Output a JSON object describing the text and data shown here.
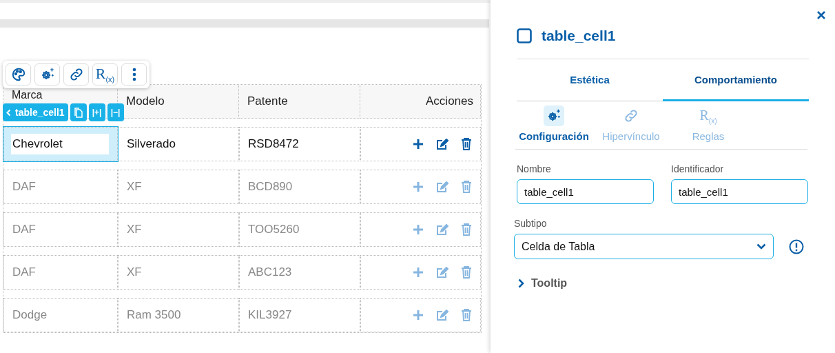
{
  "toolbar": [
    {
      "kind": "palette"
    },
    {
      "kind": "gear"
    },
    {
      "kind": "link"
    },
    {
      "kind": "rules",
      "text": "R$_{(x)}$"
    },
    {
      "kind": "more"
    }
  ],
  "element_chip": {
    "label": "table_cell1",
    "buttons": [
      {
        "kind": "copy"
      },
      {
        "kind": "text",
        "text": "|+|"
      },
      {
        "kind": "text",
        "text": "|−|"
      }
    ]
  },
  "table": {
    "columns": [
      "Marca",
      "Modelo",
      "Patente",
      "Acciones"
    ],
    "rows": [
      {
        "cells": [
          "Chevrolet",
          "Silverado",
          "RSD8472"
        ],
        "active": true,
        "selected": true
      },
      {
        "cells": [
          "DAF",
          "XF",
          "BCD890"
        ],
        "active": false,
        "selected": false
      },
      {
        "cells": [
          "DAF",
          "XF",
          "TOO5260"
        ],
        "active": false,
        "selected": false
      },
      {
        "cells": [
          "DAF",
          "XF",
          "ABC123"
        ],
        "active": false,
        "selected": false
      },
      {
        "cells": [
          "Dodge",
          "Ram 3500",
          "KIL3927"
        ],
        "active": false,
        "selected": false
      }
    ]
  },
  "panel": {
    "title": "table_cell1",
    "tabs": [
      {
        "label": "Estética",
        "selected": false
      },
      {
        "label": "Comportamiento",
        "selected": true
      }
    ],
    "subtabs": [
      {
        "kind": "gear",
        "label": "Configuración",
        "selected": true
      },
      {
        "kind": "link",
        "label": "Hipervínculo",
        "selected": false
      },
      {
        "kind": "rules",
        "label": "Reglas",
        "text": "R$_{(x)}$",
        "selected": false
      }
    ],
    "fields": [
      {
        "label": "Nombre",
        "value": "table_cell1"
      },
      {
        "label": "Identificador",
        "value": "table_cell1"
      }
    ],
    "subtype": {
      "label": "Subtipo",
      "value": "Celda de Tabla"
    },
    "sections": [
      {
        "label": "Tooltip",
        "expanded": false
      }
    ]
  }
}
